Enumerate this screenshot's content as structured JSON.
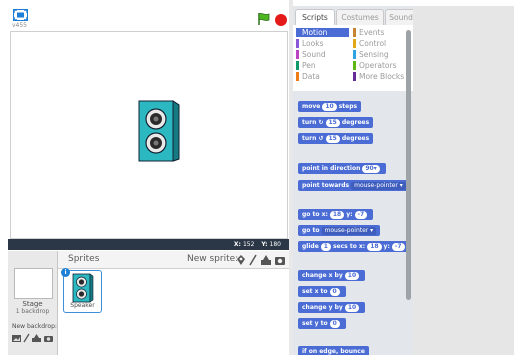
{
  "stage": {
    "version_label": "v455",
    "coords": {
      "x_label": "X:",
      "x_value": "152",
      "y_label": "Y:",
      "y_value": "180"
    }
  },
  "sprites_pane": {
    "title": "Sprites",
    "new_sprite_label": "New sprite:",
    "stage_label": "Stage",
    "stage_backdrops": "1 backdrop",
    "new_backdrop_label": "New backdrop:",
    "sprites": [
      {
        "name": "Speaker",
        "info": "i"
      }
    ]
  },
  "tabs": [
    {
      "label": "Scripts",
      "active": true
    },
    {
      "label": "Costumes",
      "active": false
    },
    {
      "label": "Sounds",
      "active": false
    }
  ],
  "categories": [
    {
      "label": "Motion",
      "color": "#4a6cd4",
      "active": true
    },
    {
      "label": "Events",
      "color": "#c88330",
      "active": false
    },
    {
      "label": "Looks",
      "color": "#8a55d7",
      "active": false
    },
    {
      "label": "Control",
      "color": "#e1a91a",
      "active": false
    },
    {
      "label": "Sound",
      "color": "#bb42c3",
      "active": false
    },
    {
      "label": "Sensing",
      "color": "#2ca5e2",
      "active": false
    },
    {
      "label": "Pen",
      "color": "#0e9a6c",
      "active": false
    },
    {
      "label": "Operators",
      "color": "#5cb712",
      "active": false
    },
    {
      "label": "Data",
      "color": "#ee7d16",
      "active": false
    },
    {
      "label": "More Blocks",
      "color": "#632d99",
      "active": false
    }
  ],
  "blocks": {
    "move": {
      "pre": "move",
      "value": "10",
      "post": "steps"
    },
    "turn_right": {
      "pre": "turn",
      "value": "15",
      "post": "degrees"
    },
    "turn_left": {
      "pre": "turn",
      "value": "15",
      "post": "degrees"
    },
    "point_direction": {
      "pre": "point in direction",
      "value": "90▾"
    },
    "point_towards": {
      "pre": "point towards",
      "option": "mouse-pointer ▾"
    },
    "go_to_xy": {
      "pre": "go to x:",
      "x": "18",
      "mid": "y:",
      "y": "-7"
    },
    "go_to": {
      "pre": "go to",
      "option": "mouse-pointer ▾"
    },
    "glide": {
      "pre": "glide",
      "secs": "1",
      "mid1": "secs to x:",
      "x": "18",
      "mid2": "y:",
      "y": "-7"
    },
    "change_x": {
      "pre": "change x by",
      "value": "10"
    },
    "set_x": {
      "pre": "set x to",
      "value": "0"
    },
    "change_y": {
      "pre": "change y by",
      "value": "10"
    },
    "set_y": {
      "pre": "set y to",
      "value": "0"
    },
    "bounce": {
      "pre": "if on edge, bounce"
    }
  }
}
